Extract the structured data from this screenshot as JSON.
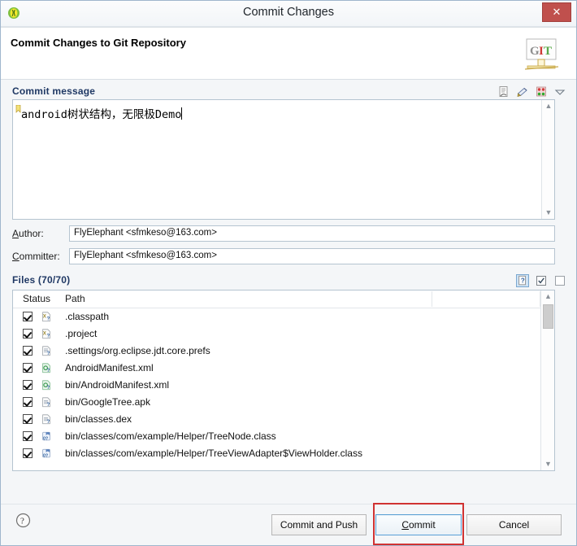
{
  "window": {
    "title": "Commit Changes",
    "icon": "eclipse-icon",
    "close_label": "✕"
  },
  "banner": {
    "title": "Commit Changes to Git Repository",
    "logo_text": "GIT",
    "logo_letters": [
      "G",
      "I",
      "T"
    ]
  },
  "commit_message": {
    "section_label": "Commit message",
    "value": "android树状结构，无限极Demo",
    "toolbar_icons": [
      "signed-off-icon",
      "change-id-icon",
      "amend-commit-icon",
      "view-menu-chevron-icon"
    ]
  },
  "author": {
    "label_mnemonic": "A",
    "label_rest": "uthor:",
    "value": "FlyElephant <sfmkeso@163.com>"
  },
  "committer": {
    "label_mnemonic": "C",
    "label_rest": "ommitter:",
    "value": "FlyElephant <sfmkeso@163.com>"
  },
  "files": {
    "section_label": "Files (70/70)",
    "toolbar_icons": [
      "show-untracked-files-icon",
      "select-all-icon",
      "deselect-all-icon"
    ],
    "columns": [
      "Status",
      "Path"
    ],
    "rows": [
      {
        "checked": true,
        "icon": "xml-untracked-icon",
        "path": ".classpath"
      },
      {
        "checked": true,
        "icon": "xml-untracked-icon",
        "path": ".project"
      },
      {
        "checked": true,
        "icon": "prefs-untracked-icon",
        "path": ".settings/org.eclipse.jdt.core.prefs"
      },
      {
        "checked": true,
        "icon": "android-xml-untracked-icon",
        "path": "AndroidManifest.xml"
      },
      {
        "checked": true,
        "icon": "android-xml-untracked-icon",
        "path": "bin/AndroidManifest.xml"
      },
      {
        "checked": true,
        "icon": "file-untracked-icon",
        "path": "bin/GoogleTree.apk"
      },
      {
        "checked": true,
        "icon": "file-untracked-icon",
        "path": "bin/classes.dex"
      },
      {
        "checked": true,
        "icon": "class-untracked-icon",
        "path": "bin/classes/com/example/Helper/TreeNode.class"
      },
      {
        "checked": true,
        "icon": "class-untracked-icon",
        "path": "bin/classes/com/example/Helper/TreeViewAdapter$ViewHolder.class"
      }
    ]
  },
  "buttons": {
    "help": "help-icon",
    "commit_and_push": "Commit and Push",
    "commit_mnemonic": "C",
    "commit_rest": "ommit",
    "cancel": "Cancel"
  },
  "colors": {
    "section_label": "#1f3864",
    "close_button": "#c0504d",
    "annotation": "#d03232",
    "focus_border": "#5a9fd4"
  }
}
